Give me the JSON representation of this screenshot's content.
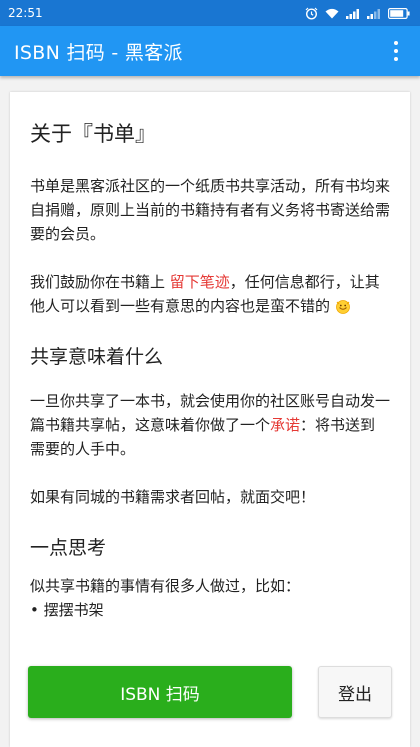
{
  "status_bar": {
    "time": "22:51",
    "icons": [
      "alarm-icon",
      "wifi-icon",
      "signal-icon",
      "signal-icon",
      "battery-icon"
    ]
  },
  "app_bar": {
    "title": "ISBN 扫码 - 黑客派",
    "menu_icon": "overflow-menu-icon"
  },
  "content": {
    "title": "关于『书单』",
    "intro": "书单是黑客派社区的一个纸质书共享活动，所有书均来自捐赠，原则上当前的书籍持有者有义务将书寄送给需要的会员。",
    "encourage_before": "我们鼓励你在书籍上 ",
    "encourage_highlight": "留下笔迹",
    "encourage_after": "，任何信息都行，让其他人可以看到一些有意思的内容也是蛮不错的 ",
    "section_share_title": "共享意味着什么",
    "share_p1_before": "一旦你共享了一本书，就会使用你的社区账号自动发一篇书籍共享帖，这意味着你做了一个",
    "share_p1_highlight": "承诺",
    "share_p1_after": "：将书送到需要的人手中。",
    "share_p2": "如果有同城的书籍需求者回帖，就面交吧！",
    "section_think_title": "一点思考",
    "think_p1": "似共享书籍的事情有很多人做过，比如：",
    "think_list": [
      "• 摆摆书架"
    ]
  },
  "actions": {
    "scan_label": "ISBN 扫码",
    "logout_label": "登出"
  },
  "colors": {
    "status_bar": "#1976d2",
    "app_bar": "#2196f3",
    "highlight": "#e53935",
    "primary_button": "#2aae1c"
  }
}
